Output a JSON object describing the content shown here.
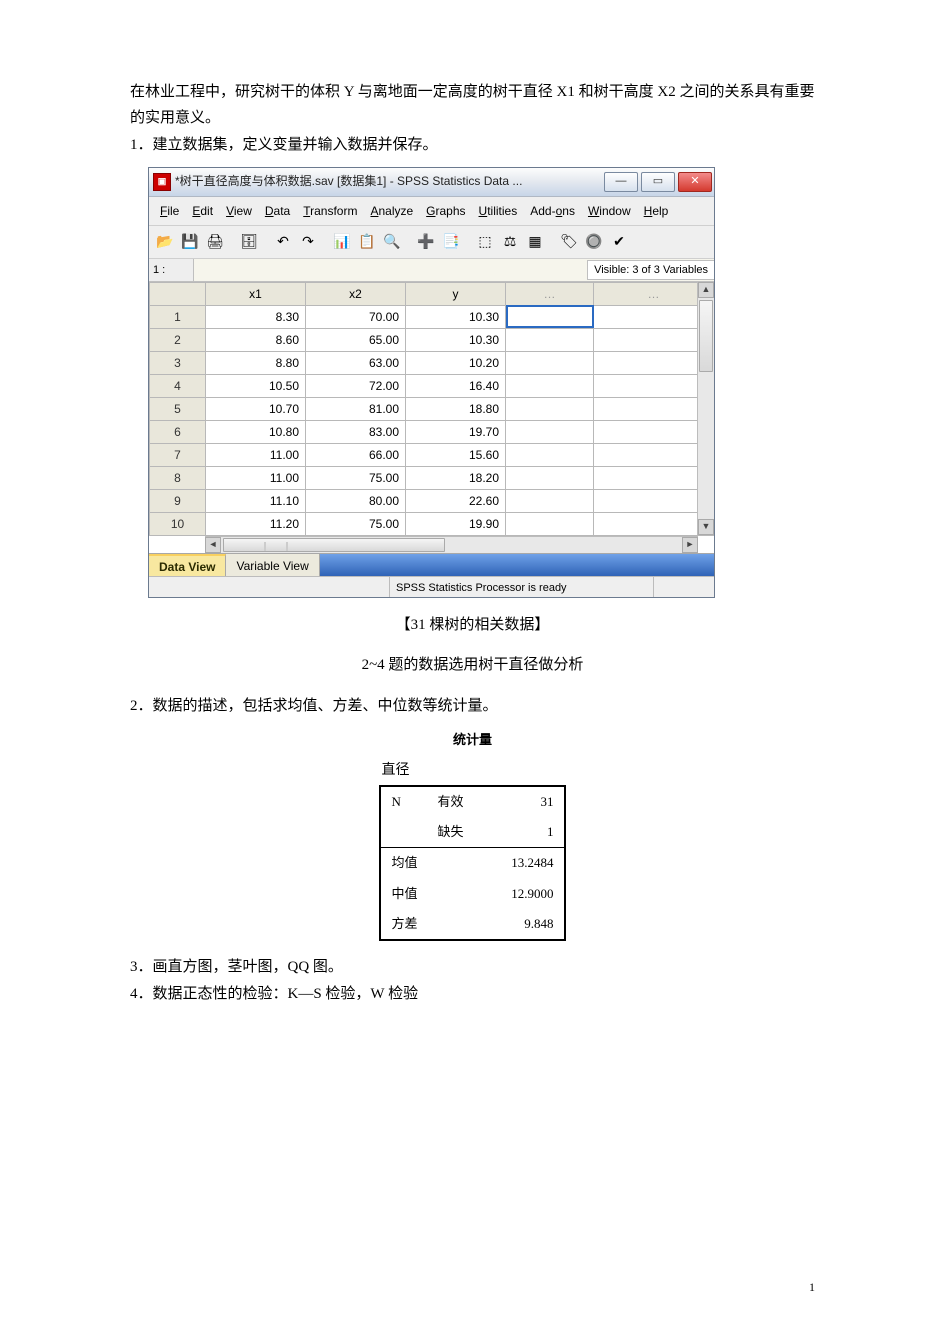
{
  "intro": "在林业工程中，研究树干的体积 Y 与离地面一定高度的树干直径 X1 和树干高度 X2 之间的关系具有重要的实用意义。",
  "list": {
    "item1": "1．建立数据集，定义变量并输入数据并保存。",
    "caption1": "【31 棵树的相关数据】",
    "caption2": "2~4 题的数据选用树干直径做分析",
    "item2": "2．数据的描述，包括求均值、方差、中位数等统计量。",
    "item3": "3．画直方图，茎叶图，QQ 图。",
    "item4": "4．数据正态性的检验：K—S 检验，W 检验"
  },
  "spss": {
    "title": "*树干直径高度与体积数据.sav [数据集1] - SPSS Statistics Data ...",
    "menus": [
      "File",
      "Edit",
      "View",
      "Data",
      "Transform",
      "Analyze",
      "Graphs",
      "Utilities",
      "Add-ons",
      "Window",
      "Help"
    ],
    "cell_ref": "1 :",
    "visible_text": "Visible: 3 of 3 Variables",
    "columns": [
      "x1",
      "x2",
      "y"
    ],
    "rows": [
      {
        "n": "1",
        "x1": "8.30",
        "x2": "70.00",
        "y": "10.30"
      },
      {
        "n": "2",
        "x1": "8.60",
        "x2": "65.00",
        "y": "10.30"
      },
      {
        "n": "3",
        "x1": "8.80",
        "x2": "63.00",
        "y": "10.20"
      },
      {
        "n": "4",
        "x1": "10.50",
        "x2": "72.00",
        "y": "16.40"
      },
      {
        "n": "5",
        "x1": "10.70",
        "x2": "81.00",
        "y": "18.80"
      },
      {
        "n": "6",
        "x1": "10.80",
        "x2": "83.00",
        "y": "19.70"
      },
      {
        "n": "7",
        "x1": "11.00",
        "x2": "66.00",
        "y": "15.60"
      },
      {
        "n": "8",
        "x1": "11.00",
        "x2": "75.00",
        "y": "18.20"
      },
      {
        "n": "9",
        "x1": "11.10",
        "x2": "80.00",
        "y": "22.60"
      },
      {
        "n": "10",
        "x1": "11.20",
        "x2": "75.00",
        "y": "19.90"
      }
    ],
    "tabs": {
      "data_view": "Data View",
      "variable_view": "Variable View"
    },
    "status": "SPSS Statistics Processor is ready"
  },
  "toolbar_icons": {
    "open": "📂",
    "save": "💾",
    "print": "🖨",
    "recall": "🗄",
    "undo": "↶",
    "redo": "↷",
    "goto": "📊",
    "vars": "📋",
    "find": "🔍",
    "insert_case": "➕",
    "insert_var": "📑",
    "split": "⬚",
    "weight": "⚖",
    "select": "▦",
    "value_labels": "🏷",
    "use_sets": "🔘",
    "spell": "✔"
  },
  "stats": {
    "title": "统计量",
    "var": "直径",
    "rows": [
      {
        "k1": "N",
        "k2": "有效",
        "v": "31"
      },
      {
        "k1": "",
        "k2": "缺失",
        "v": "1"
      },
      {
        "k1": "均值",
        "k2": "",
        "v": "13.2484"
      },
      {
        "k1": "中值",
        "k2": "",
        "v": "12.9000"
      },
      {
        "k1": "方差",
        "k2": "",
        "v": "9.848"
      }
    ]
  },
  "page_number": "1"
}
